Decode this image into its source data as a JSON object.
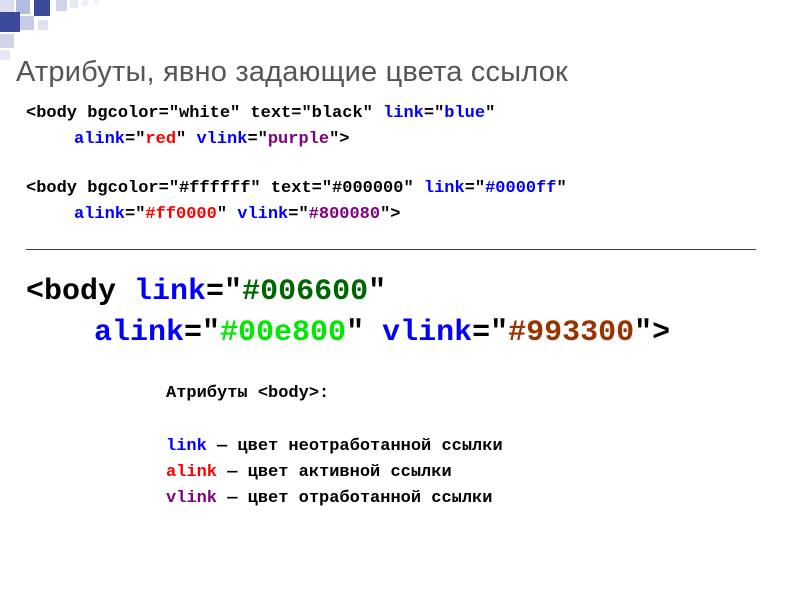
{
  "title": "Атрибуты, явно задающие цвета ссылок",
  "ex1": {
    "line1": {
      "pre": "<body bgcolor=\"white\" text=\"black\" ",
      "link_attr": "link",
      "eq1": "=\"",
      "link_val": "blue",
      "q1": "\""
    },
    "line2": {
      "alink_attr": "alink",
      "eq2": "=\"",
      "alink_val": "red",
      "q2": "\" ",
      "vlink_attr": "vlink",
      "eq3": "=\"",
      "vlink_val": "purple",
      "q3": "\">"
    }
  },
  "ex2": {
    "line1": {
      "pre": "<body bgcolor=\"#ffffff\" text=\"#000000\" ",
      "link_attr": "link",
      "eq1": "=\"",
      "link_val": "#0000ff",
      "q1": "\""
    },
    "line2": {
      "alink_attr": "alink",
      "eq2": "=\"",
      "alink_val": "#ff0000",
      "q2": "\" ",
      "vlink_attr": "vlink",
      "eq3": "=\"",
      "vlink_val": "#800080",
      "q3": "\">"
    }
  },
  "ex3": {
    "line1": {
      "pre": "<body ",
      "link_attr": "link",
      "eq1": "=\"",
      "link_val": "#006600",
      "q1": "\""
    },
    "line2": {
      "alink_attr": "alink",
      "eq2": "=\"",
      "alink_val": "#00e800",
      "q2": "\" ",
      "vlink_attr": "vlink",
      "eq3": "=\"",
      "vlink_val": "#993300",
      "q3": "\">"
    }
  },
  "notes": {
    "header": "Атрибуты <body>:",
    "link_name": "link",
    "link_desc": " — цвет неотработанной ссылки",
    "alink_name": "alink",
    "alink_desc": " — цвет активной ссылки",
    "vlink_name": "vlink",
    "vlink_desc": " — цвет отработанной ссылки"
  }
}
